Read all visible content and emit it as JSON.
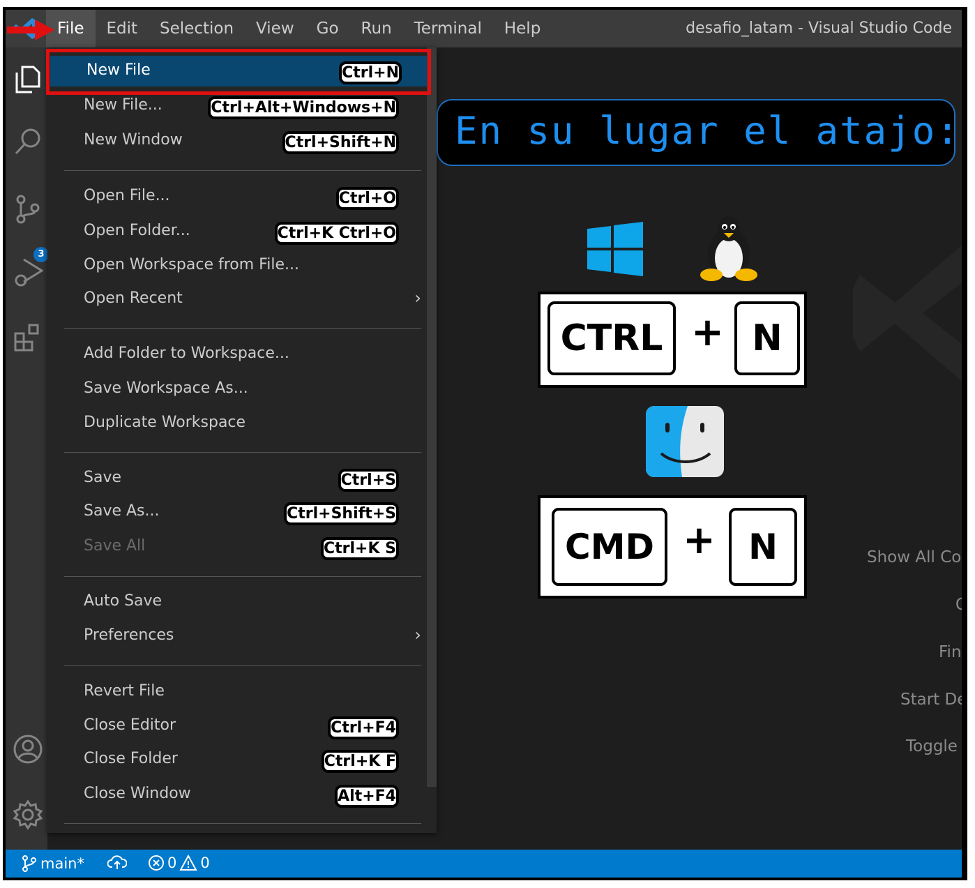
{
  "app": {
    "title": "desafio_latam - Visual Studio Code"
  },
  "menubar": {
    "items": [
      "File",
      "Edit",
      "Selection",
      "View",
      "Go",
      "Run",
      "Terminal",
      "Help"
    ]
  },
  "activity": {
    "source_control_badge": "3"
  },
  "file_menu": {
    "new_file": {
      "label": "New File",
      "key": "Ctrl+N"
    },
    "new_file_dots": {
      "label": "New File...",
      "key": "Ctrl+Alt+Windows+N"
    },
    "new_window": {
      "label": "New Window",
      "key": "Ctrl+Shift+N"
    },
    "open_file": {
      "label": "Open File...",
      "key": "Ctrl+O"
    },
    "open_folder": {
      "label": "Open Folder...",
      "key": "Ctrl+K Ctrl+O"
    },
    "open_workspace": {
      "label": "Open Workspace from File..."
    },
    "open_recent": {
      "label": "Open Recent"
    },
    "add_folder": {
      "label": "Add Folder to Workspace..."
    },
    "save_workspace_as": {
      "label": "Save Workspace As..."
    },
    "duplicate_workspace": {
      "label": "Duplicate Workspace"
    },
    "save": {
      "label": "Save",
      "key": "Ctrl+S"
    },
    "save_as": {
      "label": "Save As...",
      "key": "Ctrl+Shift+S"
    },
    "save_all": {
      "label": "Save All",
      "key": "Ctrl+K S"
    },
    "auto_save": {
      "label": "Auto Save"
    },
    "preferences": {
      "label": "Preferences"
    },
    "revert_file": {
      "label": "Revert File"
    },
    "close_editor": {
      "label": "Close Editor",
      "key": "Ctrl+F4"
    },
    "close_folder": {
      "label": "Close Folder",
      "key": "Ctrl+K F"
    },
    "close_window": {
      "label": "Close Window",
      "key": "Alt+F4"
    }
  },
  "callout": {
    "text": "En su lugar el atajo:"
  },
  "shortcuts": {
    "win_linux": {
      "key1": "CTRL",
      "plus": "+",
      "key2": "N"
    },
    "mac": {
      "key1": "CMD",
      "plus": "+",
      "key2": "N"
    }
  },
  "welcome": {
    "show_all": "Show All Co",
    "open": "O",
    "find": "Fin",
    "start_debug": "Start De",
    "toggle": "Toggle"
  },
  "statusbar": {
    "branch": "main*",
    "errors": "0",
    "warnings": "0"
  },
  "colors": {
    "accent": "#007acc",
    "menu_selected": "#094771",
    "annotation_red": "#e01010",
    "callout_text": "#1e8ff0"
  }
}
